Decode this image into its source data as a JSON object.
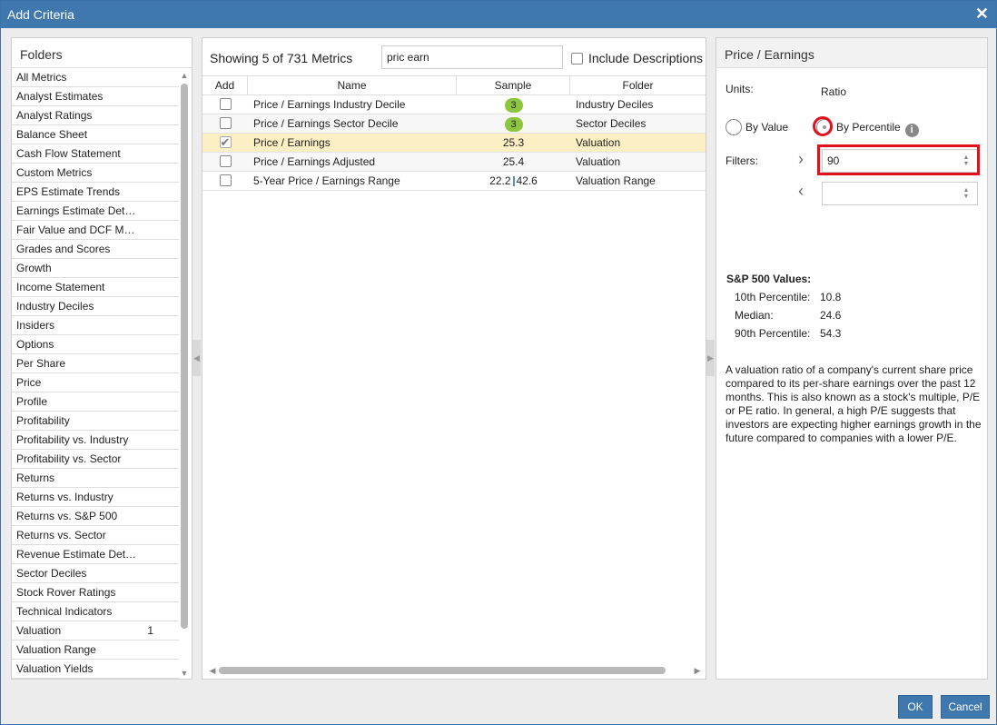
{
  "dialog": {
    "title": "Add Criteria"
  },
  "folders": {
    "header": "Folders",
    "items": [
      {
        "label": "All Metrics",
        "count": ""
      },
      {
        "label": "Analyst Estimates",
        "count": ""
      },
      {
        "label": "Analyst Ratings",
        "count": ""
      },
      {
        "label": "Balance Sheet",
        "count": ""
      },
      {
        "label": "Cash Flow Statement",
        "count": ""
      },
      {
        "label": "Custom Metrics",
        "count": ""
      },
      {
        "label": "EPS Estimate Trends",
        "count": ""
      },
      {
        "label": "Earnings Estimate Det…",
        "count": ""
      },
      {
        "label": "Fair Value and DCF M…",
        "count": ""
      },
      {
        "label": "Grades and Scores",
        "count": ""
      },
      {
        "label": "Growth",
        "count": ""
      },
      {
        "label": "Income Statement",
        "count": ""
      },
      {
        "label": "Industry Deciles",
        "count": ""
      },
      {
        "label": "Insiders",
        "count": ""
      },
      {
        "label": "Options",
        "count": ""
      },
      {
        "label": "Per Share",
        "count": ""
      },
      {
        "label": "Price",
        "count": ""
      },
      {
        "label": "Profile",
        "count": ""
      },
      {
        "label": "Profitability",
        "count": ""
      },
      {
        "label": "Profitability vs. Industry",
        "count": ""
      },
      {
        "label": "Profitability vs. Sector",
        "count": ""
      },
      {
        "label": "Returns",
        "count": ""
      },
      {
        "label": "Returns vs. Industry",
        "count": ""
      },
      {
        "label": "Returns vs. S&P 500",
        "count": ""
      },
      {
        "label": "Returns vs. Sector",
        "count": ""
      },
      {
        "label": "Revenue Estimate Det…",
        "count": ""
      },
      {
        "label": "Sector Deciles",
        "count": ""
      },
      {
        "label": "Stock Rover Ratings",
        "count": ""
      },
      {
        "label": "Technical Indicators",
        "count": ""
      },
      {
        "label": "Valuation",
        "count": "1"
      },
      {
        "label": "Valuation Range",
        "count": ""
      },
      {
        "label": "Valuation Yields",
        "count": ""
      }
    ]
  },
  "metrics": {
    "showing": "Showing 5 of 731 Metrics",
    "search_value": "pric earn",
    "include_descriptions": "Include Descriptions",
    "columns": {
      "add": "Add",
      "name": "Name",
      "sample": "Sample",
      "folder": "Folder"
    },
    "rows": [
      {
        "name": "Price / Earnings Industry Decile",
        "sample": "3",
        "sample_low": "",
        "sample_high": "",
        "folder": "Industry Deciles",
        "checked": false
      },
      {
        "name": "Price / Earnings Sector Decile",
        "sample": "3",
        "sample_low": "",
        "sample_high": "",
        "folder": "Sector Deciles",
        "checked": false
      },
      {
        "name": "Price / Earnings",
        "sample": "25.3",
        "sample_low": "",
        "sample_high": "",
        "folder": "Valuation",
        "checked": true
      },
      {
        "name": "Price / Earnings Adjusted",
        "sample": "25.4",
        "sample_low": "",
        "sample_high": "",
        "folder": "Valuation",
        "checked": false
      },
      {
        "name": "5-Year Price / Earnings Range",
        "sample": "",
        "sample_low": "22.2",
        "sample_high": "42.6",
        "folder": "Valuation Range",
        "checked": false
      }
    ]
  },
  "detail": {
    "title": "Price / Earnings",
    "units_label": "Units:",
    "units_value": "Ratio",
    "by_value": "By Value",
    "by_percentile": "By Percentile",
    "filters_label": "Filters:",
    "filter_gt_value": "90",
    "filter_lt_value": "",
    "sp500_title": "S&P 500 Values:",
    "sp500": [
      {
        "label": "10th Percentile:",
        "value": "10.8"
      },
      {
        "label": "Median:",
        "value": "24.6"
      },
      {
        "label": "90th Percentile:",
        "value": "54.3"
      }
    ],
    "description": "A valuation ratio of a company's current share price compared to its per-share earnings over the past 12 months. This is also known as a stock's multiple, P/E or PE ratio. In general, a high P/E suggests that investors are expecting higher earnings growth in the future compared to companies with a lower P/E."
  },
  "footer": {
    "ok": "OK",
    "cancel": "Cancel"
  },
  "colors": {
    "titlebar": "#3f78ae",
    "selected_row": "#fcefc4",
    "pill": "#8cc63f",
    "highlight": "#e0101d"
  }
}
